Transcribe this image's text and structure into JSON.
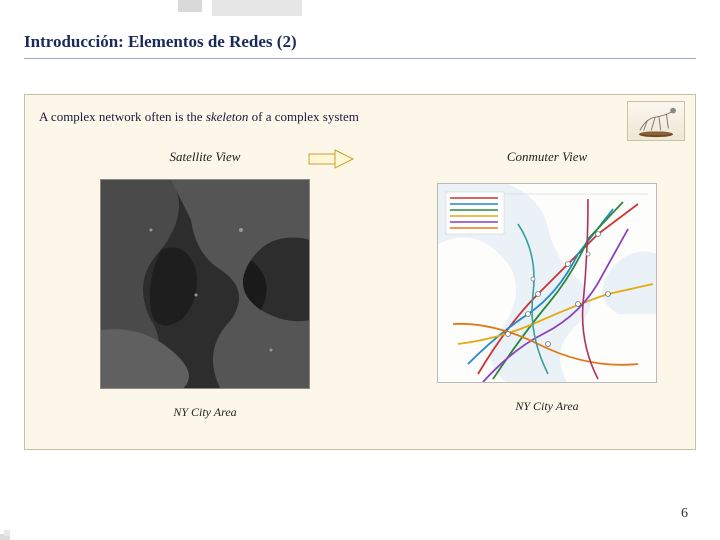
{
  "title": "Introducción: Elementos de Redes (2)",
  "statement_pre": "A complex network often is the ",
  "statement_em": "skeleton",
  "statement_post": " of a complex system",
  "left": {
    "heading": "Satellite View",
    "caption": "NY City Area"
  },
  "right": {
    "heading": "Conmuter View",
    "caption": "NY City Area"
  },
  "page_number": "6"
}
